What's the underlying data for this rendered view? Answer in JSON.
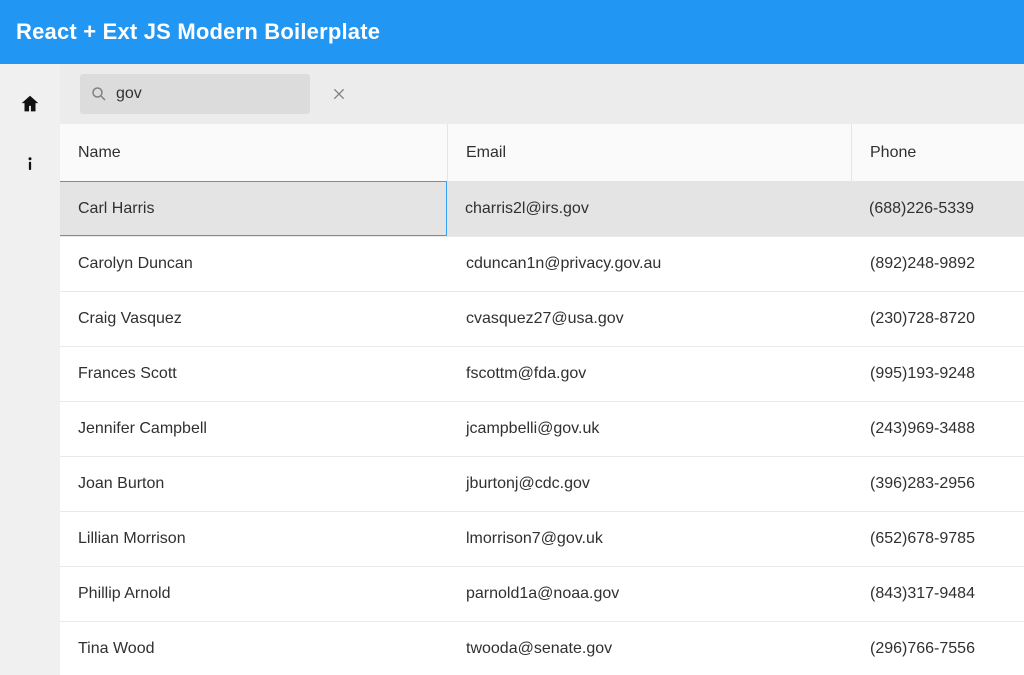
{
  "header": {
    "title": "React + Ext JS Modern Boilerplate"
  },
  "search": {
    "value": "gov",
    "placeholder": ""
  },
  "columns": {
    "name": "Name",
    "email": "Email",
    "phone": "Phone"
  },
  "rows": [
    {
      "name": "Carl Harris",
      "email": "charris2l@irs.gov",
      "phone": "(688)226-5339",
      "selected": true
    },
    {
      "name": "Carolyn Duncan",
      "email": "cduncan1n@privacy.gov.au",
      "phone": "(892)248-9892",
      "selected": false
    },
    {
      "name": "Craig Vasquez",
      "email": "cvasquez27@usa.gov",
      "phone": "(230)728-8720",
      "selected": false
    },
    {
      "name": "Frances Scott",
      "email": "fscottm@fda.gov",
      "phone": "(995)193-9248",
      "selected": false
    },
    {
      "name": "Jennifer Campbell",
      "email": "jcampbelli@gov.uk",
      "phone": "(243)969-3488",
      "selected": false
    },
    {
      "name": "Joan Burton",
      "email": "jburtonj@cdc.gov",
      "phone": "(396)283-2956",
      "selected": false
    },
    {
      "name": "Lillian Morrison",
      "email": "lmorrison7@gov.uk",
      "phone": "(652)678-9785",
      "selected": false
    },
    {
      "name": "Phillip Arnold",
      "email": "parnold1a@noaa.gov",
      "phone": "(843)317-9484",
      "selected": false
    },
    {
      "name": "Tina Wood",
      "email": "twooda@senate.gov",
      "phone": "(296)766-7556",
      "selected": false
    }
  ]
}
